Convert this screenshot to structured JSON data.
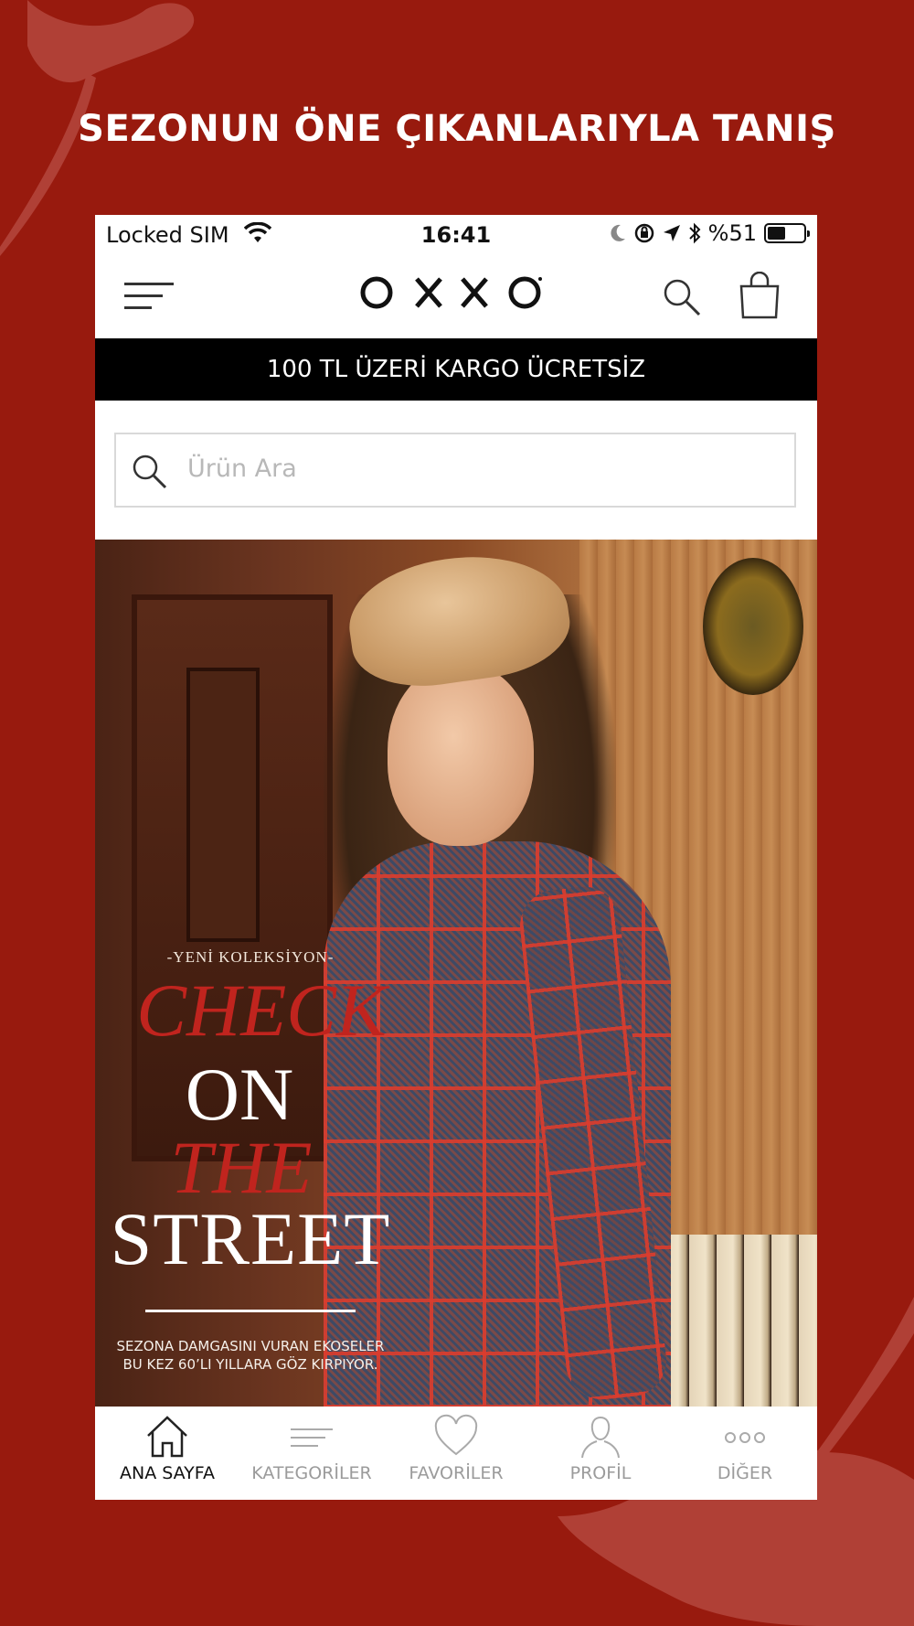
{
  "headline": "SEZONUN ÖNE ÇIKANLARIYLA TANIŞ",
  "status_bar": {
    "carrier": "Locked SIM",
    "time": "16:41",
    "battery_text": "%51",
    "battery_level": 0.51
  },
  "nav": {
    "logo": "OXXO",
    "menu_icon": "hamburger-menu-icon",
    "search_icon": "search-icon",
    "bag_icon": "shopping-bag-icon"
  },
  "promo": "100 TL ÜZERİ KARGO ÜCRETSİZ",
  "search": {
    "placeholder": "Ürün Ara"
  },
  "banner": {
    "kicker": "-YENİ KOLEKSİYON-",
    "line1": "CHECK",
    "line2": "ON",
    "line3": "THE",
    "line4": "STREET",
    "subtitle_1": "SEZONA DAMGASINI VURAN EKOSELER",
    "subtitle_2": "BU KEZ 60’LI YILLARA GÖZ KIRPIYOR."
  },
  "tabs": [
    {
      "label": "ANA SAYFA",
      "icon": "home-icon",
      "active": true
    },
    {
      "label": "KATEGORİLER",
      "icon": "list-icon",
      "active": false
    },
    {
      "label": "FAVORİLER",
      "icon": "heart-icon",
      "active": false
    },
    {
      "label": "PROFİL",
      "icon": "user-icon",
      "active": false
    },
    {
      "label": "DİĞER",
      "icon": "more-icon",
      "active": false
    }
  ],
  "colors": {
    "background": "#981a0e",
    "accent_red": "#c0241e",
    "promo_bar": "#000000"
  }
}
